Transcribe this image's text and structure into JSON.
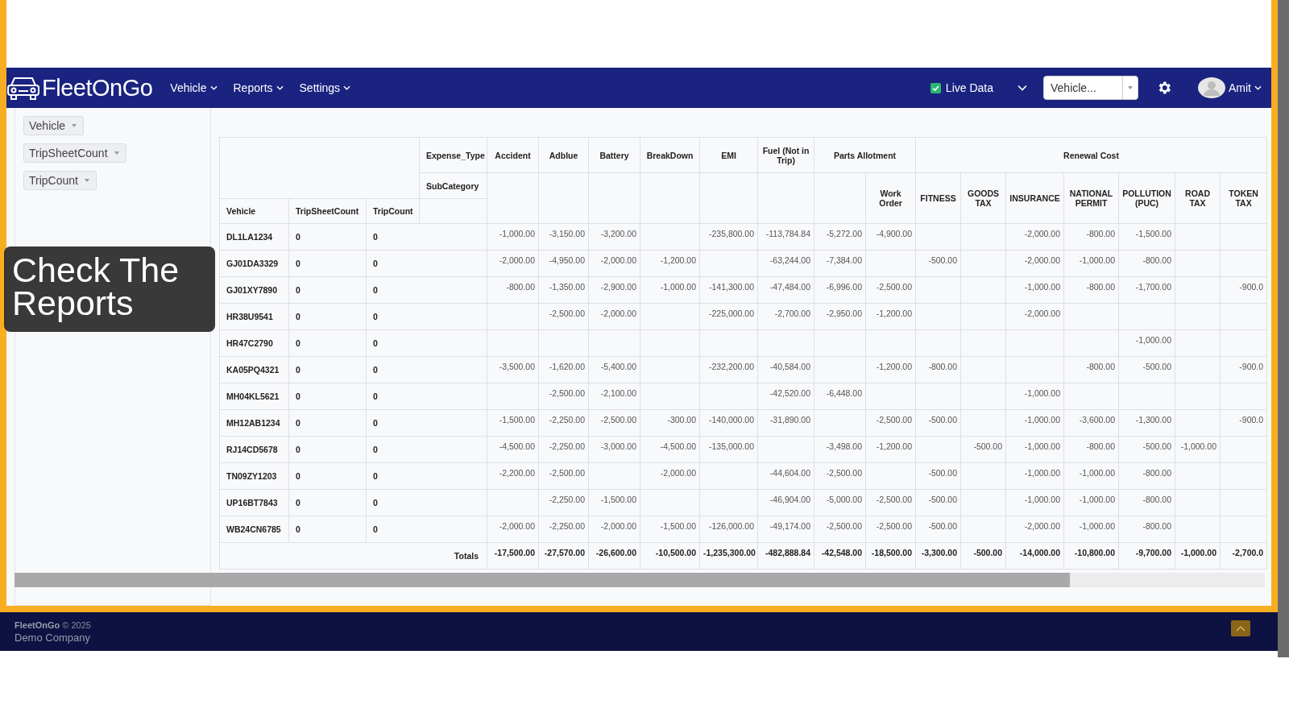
{
  "brand": "FleetOnGo",
  "nav": [
    {
      "label": "Vehicle"
    },
    {
      "label": "Reports"
    },
    {
      "label": "Settings"
    }
  ],
  "live_data": {
    "label": "Live Data",
    "checked": true
  },
  "vehicle_select": {
    "placeholder": "Vehicle..."
  },
  "user": {
    "name": "Amit"
  },
  "pivot_fields": [
    {
      "label": "Vehicle"
    },
    {
      "label": "TripSheetCount"
    },
    {
      "label": "TripCount"
    }
  ],
  "table": {
    "corner_labels": [
      "Expense_Type",
      "SubCategory"
    ],
    "row_headers": [
      "Vehicle",
      "TripSheetCount",
      "TripCount"
    ],
    "expense_types": [
      {
        "label": "Accident"
      },
      {
        "label": "Adblue"
      },
      {
        "label": "Battery"
      },
      {
        "label": "BreakDown"
      },
      {
        "label": "EMI"
      },
      {
        "label": "Fuel (Not in Trip)"
      },
      {
        "label": "Parts Allotment",
        "subcategories": [
          {
            "kind": "blank"
          },
          {
            "kind": "label",
            "label": "Work Order"
          }
        ]
      },
      {
        "label": "Renewal Cost",
        "subcategories": [
          {
            "kind": "label",
            "label": "FITNESS"
          },
          {
            "kind": "label",
            "label": "GOODS TAX"
          },
          {
            "kind": "label",
            "label": "INSURANCE"
          },
          {
            "kind": "label",
            "label": "NATIONAL PERMIT"
          },
          {
            "kind": "label",
            "label": "POLLUTION (PUC)"
          },
          {
            "kind": "label",
            "label": "ROAD TAX"
          },
          {
            "kind": "label",
            "label": "TOKEN TAX"
          }
        ]
      }
    ],
    "rows": [
      {
        "vehicle": "DL1LA1234",
        "trip_sheet_count": "0",
        "trip_count": "0",
        "values": [
          {
            "kind": "amount",
            "text": "-1,000.00"
          },
          {
            "kind": "amount",
            "text": "-3,150.00"
          },
          {
            "kind": "amount",
            "text": "-3,200.00"
          },
          {
            "kind": "empty"
          },
          {
            "kind": "amount",
            "text": "-235,800.00"
          },
          {
            "kind": "amount",
            "text": "-113,784.84"
          },
          {
            "kind": "amount",
            "text": "-5,272.00"
          },
          {
            "kind": "amount",
            "text": "-4,900.00"
          },
          {
            "kind": "empty"
          },
          {
            "kind": "empty"
          },
          {
            "kind": "amount",
            "text": "-2,000.00"
          },
          {
            "kind": "amount",
            "text": "-800.00"
          },
          {
            "kind": "amount",
            "text": "-1,500.00"
          },
          {
            "kind": "empty"
          },
          {
            "kind": "empty"
          }
        ]
      },
      {
        "vehicle": "GJ01DA3329",
        "trip_sheet_count": "0",
        "trip_count": "0",
        "values": [
          {
            "kind": "amount",
            "text": "-2,000.00"
          },
          {
            "kind": "amount",
            "text": "-4,950.00"
          },
          {
            "kind": "amount",
            "text": "-2,000.00"
          },
          {
            "kind": "amount",
            "text": "-1,200.00"
          },
          {
            "kind": "empty"
          },
          {
            "kind": "amount",
            "text": "-63,244.00"
          },
          {
            "kind": "amount",
            "text": "-7,384.00"
          },
          {
            "kind": "empty"
          },
          {
            "kind": "amount",
            "text": "-500.00"
          },
          {
            "kind": "empty"
          },
          {
            "kind": "amount",
            "text": "-2,000.00"
          },
          {
            "kind": "amount",
            "text": "-1,000.00"
          },
          {
            "kind": "amount",
            "text": "-800.00"
          },
          {
            "kind": "empty"
          },
          {
            "kind": "empty"
          }
        ]
      },
      {
        "vehicle": "GJ01XY7890",
        "trip_sheet_count": "0",
        "trip_count": "0",
        "values": [
          {
            "kind": "amount",
            "text": "-800.00"
          },
          {
            "kind": "amount",
            "text": "-1,350.00"
          },
          {
            "kind": "amount",
            "text": "-2,900.00"
          },
          {
            "kind": "amount",
            "text": "-1,000.00"
          },
          {
            "kind": "amount",
            "text": "-141,300.00"
          },
          {
            "kind": "amount",
            "text": "-47,484.00"
          },
          {
            "kind": "amount",
            "text": "-6,996.00"
          },
          {
            "kind": "amount",
            "text": "-2,500.00"
          },
          {
            "kind": "empty"
          },
          {
            "kind": "empty"
          },
          {
            "kind": "amount",
            "text": "-1,000.00"
          },
          {
            "kind": "amount",
            "text": "-800.00"
          },
          {
            "kind": "amount",
            "text": "-1,700.00"
          },
          {
            "kind": "empty"
          },
          {
            "kind": "amount",
            "text": "-900.0"
          }
        ]
      },
      {
        "vehicle": "HR38U9541",
        "trip_sheet_count": "0",
        "trip_count": "0",
        "values": [
          {
            "kind": "empty"
          },
          {
            "kind": "amount",
            "text": "-2,500.00"
          },
          {
            "kind": "amount",
            "text": "-2,000.00"
          },
          {
            "kind": "empty"
          },
          {
            "kind": "amount",
            "text": "-225,000.00"
          },
          {
            "kind": "amount",
            "text": "-2,700.00"
          },
          {
            "kind": "amount",
            "text": "-2,950.00"
          },
          {
            "kind": "amount",
            "text": "-1,200.00"
          },
          {
            "kind": "empty"
          },
          {
            "kind": "empty"
          },
          {
            "kind": "amount",
            "text": "-2,000.00"
          },
          {
            "kind": "empty"
          },
          {
            "kind": "empty"
          },
          {
            "kind": "empty"
          },
          {
            "kind": "empty"
          }
        ]
      },
      {
        "vehicle": "HR47C2790",
        "trip_sheet_count": "0",
        "trip_count": "0",
        "values": [
          {
            "kind": "empty"
          },
          {
            "kind": "empty"
          },
          {
            "kind": "empty"
          },
          {
            "kind": "empty"
          },
          {
            "kind": "empty"
          },
          {
            "kind": "empty"
          },
          {
            "kind": "empty"
          },
          {
            "kind": "empty"
          },
          {
            "kind": "empty"
          },
          {
            "kind": "empty"
          },
          {
            "kind": "empty"
          },
          {
            "kind": "empty"
          },
          {
            "kind": "amount",
            "text": "-1,000.00"
          },
          {
            "kind": "empty"
          },
          {
            "kind": "empty"
          }
        ]
      },
      {
        "vehicle": "KA05PQ4321",
        "trip_sheet_count": "0",
        "trip_count": "0",
        "values": [
          {
            "kind": "amount",
            "text": "-3,500.00"
          },
          {
            "kind": "amount",
            "text": "-1,620.00"
          },
          {
            "kind": "amount",
            "text": "-5,400.00"
          },
          {
            "kind": "empty"
          },
          {
            "kind": "amount",
            "text": "-232,200.00"
          },
          {
            "kind": "amount",
            "text": "-40,584.00"
          },
          {
            "kind": "empty"
          },
          {
            "kind": "amount",
            "text": "-1,200.00"
          },
          {
            "kind": "amount",
            "text": "-800.00"
          },
          {
            "kind": "empty"
          },
          {
            "kind": "empty"
          },
          {
            "kind": "amount",
            "text": "-800.00"
          },
          {
            "kind": "amount",
            "text": "-500.00"
          },
          {
            "kind": "empty"
          },
          {
            "kind": "amount",
            "text": "-900.0"
          }
        ]
      },
      {
        "vehicle": "MH04KL5621",
        "trip_sheet_count": "0",
        "trip_count": "0",
        "values": [
          {
            "kind": "empty"
          },
          {
            "kind": "amount",
            "text": "-2,500.00"
          },
          {
            "kind": "amount",
            "text": "-2,100.00"
          },
          {
            "kind": "empty"
          },
          {
            "kind": "empty"
          },
          {
            "kind": "amount",
            "text": "-42,520.00"
          },
          {
            "kind": "amount",
            "text": "-6,448.00"
          },
          {
            "kind": "empty"
          },
          {
            "kind": "empty"
          },
          {
            "kind": "empty"
          },
          {
            "kind": "amount",
            "text": "-1,000.00"
          },
          {
            "kind": "empty"
          },
          {
            "kind": "empty"
          },
          {
            "kind": "empty"
          },
          {
            "kind": "empty"
          }
        ]
      },
      {
        "vehicle": "MH12AB1234",
        "trip_sheet_count": "0",
        "trip_count": "0",
        "values": [
          {
            "kind": "amount",
            "text": "-1,500.00"
          },
          {
            "kind": "amount",
            "text": "-2,250.00"
          },
          {
            "kind": "amount",
            "text": "-2,500.00"
          },
          {
            "kind": "amount",
            "text": "-300.00"
          },
          {
            "kind": "amount",
            "text": "-140,000.00"
          },
          {
            "kind": "amount",
            "text": "-31,890.00"
          },
          {
            "kind": "empty"
          },
          {
            "kind": "amount",
            "text": "-2,500.00"
          },
          {
            "kind": "amount",
            "text": "-500.00"
          },
          {
            "kind": "empty"
          },
          {
            "kind": "amount",
            "text": "-1,000.00"
          },
          {
            "kind": "amount",
            "text": "-3,600.00"
          },
          {
            "kind": "amount",
            "text": "-1,300.00"
          },
          {
            "kind": "empty"
          },
          {
            "kind": "amount",
            "text": "-900.0"
          }
        ]
      },
      {
        "vehicle": "RJ14CD5678",
        "trip_sheet_count": "0",
        "trip_count": "0",
        "values": [
          {
            "kind": "amount",
            "text": "-4,500.00"
          },
          {
            "kind": "amount",
            "text": "-2,250.00"
          },
          {
            "kind": "amount",
            "text": "-3,000.00"
          },
          {
            "kind": "amount",
            "text": "-4,500.00"
          },
          {
            "kind": "amount",
            "text": "-135,000.00"
          },
          {
            "kind": "empty"
          },
          {
            "kind": "amount",
            "text": "-3,498.00"
          },
          {
            "kind": "amount",
            "text": "-1,200.00"
          },
          {
            "kind": "empty"
          },
          {
            "kind": "amount",
            "text": "-500.00"
          },
          {
            "kind": "amount",
            "text": "-1,000.00"
          },
          {
            "kind": "amount",
            "text": "-800.00"
          },
          {
            "kind": "amount",
            "text": "-500.00"
          },
          {
            "kind": "amount",
            "text": "-1,000.00"
          },
          {
            "kind": "empty"
          }
        ]
      },
      {
        "vehicle": "TN09ZY1203",
        "trip_sheet_count": "0",
        "trip_count": "0",
        "values": [
          {
            "kind": "amount",
            "text": "-2,200.00"
          },
          {
            "kind": "amount",
            "text": "-2,500.00"
          },
          {
            "kind": "empty"
          },
          {
            "kind": "amount",
            "text": "-2,000.00"
          },
          {
            "kind": "empty"
          },
          {
            "kind": "amount",
            "text": "-44,604.00"
          },
          {
            "kind": "amount",
            "text": "-2,500.00"
          },
          {
            "kind": "empty"
          },
          {
            "kind": "amount",
            "text": "-500.00"
          },
          {
            "kind": "empty"
          },
          {
            "kind": "amount",
            "text": "-1,000.00"
          },
          {
            "kind": "amount",
            "text": "-1,000.00"
          },
          {
            "kind": "amount",
            "text": "-800.00"
          },
          {
            "kind": "empty"
          },
          {
            "kind": "empty"
          }
        ]
      },
      {
        "vehicle": "UP16BT7843",
        "trip_sheet_count": "0",
        "trip_count": "0",
        "values": [
          {
            "kind": "empty"
          },
          {
            "kind": "amount",
            "text": "-2,250.00"
          },
          {
            "kind": "amount",
            "text": "-1,500.00"
          },
          {
            "kind": "empty"
          },
          {
            "kind": "empty"
          },
          {
            "kind": "amount",
            "text": "-46,904.00"
          },
          {
            "kind": "amount",
            "text": "-5,000.00"
          },
          {
            "kind": "amount",
            "text": "-2,500.00"
          },
          {
            "kind": "amount",
            "text": "-500.00"
          },
          {
            "kind": "empty"
          },
          {
            "kind": "amount",
            "text": "-1,000.00"
          },
          {
            "kind": "amount",
            "text": "-1,000.00"
          },
          {
            "kind": "amount",
            "text": "-800.00"
          },
          {
            "kind": "empty"
          },
          {
            "kind": "empty"
          }
        ]
      },
      {
        "vehicle": "WB24CN6785",
        "trip_sheet_count": "0",
        "trip_count": "0",
        "values": [
          {
            "kind": "amount",
            "text": "-2,000.00"
          },
          {
            "kind": "amount",
            "text": "-2,250.00"
          },
          {
            "kind": "amount",
            "text": "-2,000.00"
          },
          {
            "kind": "amount",
            "text": "-1,500.00"
          },
          {
            "kind": "amount",
            "text": "-126,000.00"
          },
          {
            "kind": "amount",
            "text": "-49,174.00"
          },
          {
            "kind": "amount",
            "text": "-2,500.00"
          },
          {
            "kind": "amount",
            "text": "-2,500.00"
          },
          {
            "kind": "amount",
            "text": "-500.00"
          },
          {
            "kind": "empty"
          },
          {
            "kind": "amount",
            "text": "-2,000.00"
          },
          {
            "kind": "amount",
            "text": "-1,000.00"
          },
          {
            "kind": "amount",
            "text": "-800.00"
          },
          {
            "kind": "empty"
          },
          {
            "kind": "empty"
          }
        ]
      }
    ],
    "totals": {
      "label": "Totals",
      "values": [
        {
          "kind": "amount",
          "text": "-17,500.00"
        },
        {
          "kind": "amount",
          "text": "-27,570.00"
        },
        {
          "kind": "amount",
          "text": "-26,600.00"
        },
        {
          "kind": "amount",
          "text": "-10,500.00"
        },
        {
          "kind": "amount",
          "text": "-1,235,300.00"
        },
        {
          "kind": "amount",
          "text": "-482,888.84"
        },
        {
          "kind": "amount",
          "text": "-42,548.00"
        },
        {
          "kind": "amount",
          "text": "-18,500.00"
        },
        {
          "kind": "amount",
          "text": "-3,300.00"
        },
        {
          "kind": "amount",
          "text": "-500.00"
        },
        {
          "kind": "amount",
          "text": "-14,000.00"
        },
        {
          "kind": "amount",
          "text": "-10,800.00"
        },
        {
          "kind": "amount",
          "text": "-9,700.00"
        },
        {
          "kind": "amount",
          "text": "-1,000.00"
        },
        {
          "kind": "amount",
          "text": "-2,700.0"
        }
      ]
    }
  },
  "callout": {
    "text": "Check The Reports"
  },
  "footer": {
    "brand": "FleetOnGo",
    "year": "© 2025",
    "company": "Demo Company"
  }
}
